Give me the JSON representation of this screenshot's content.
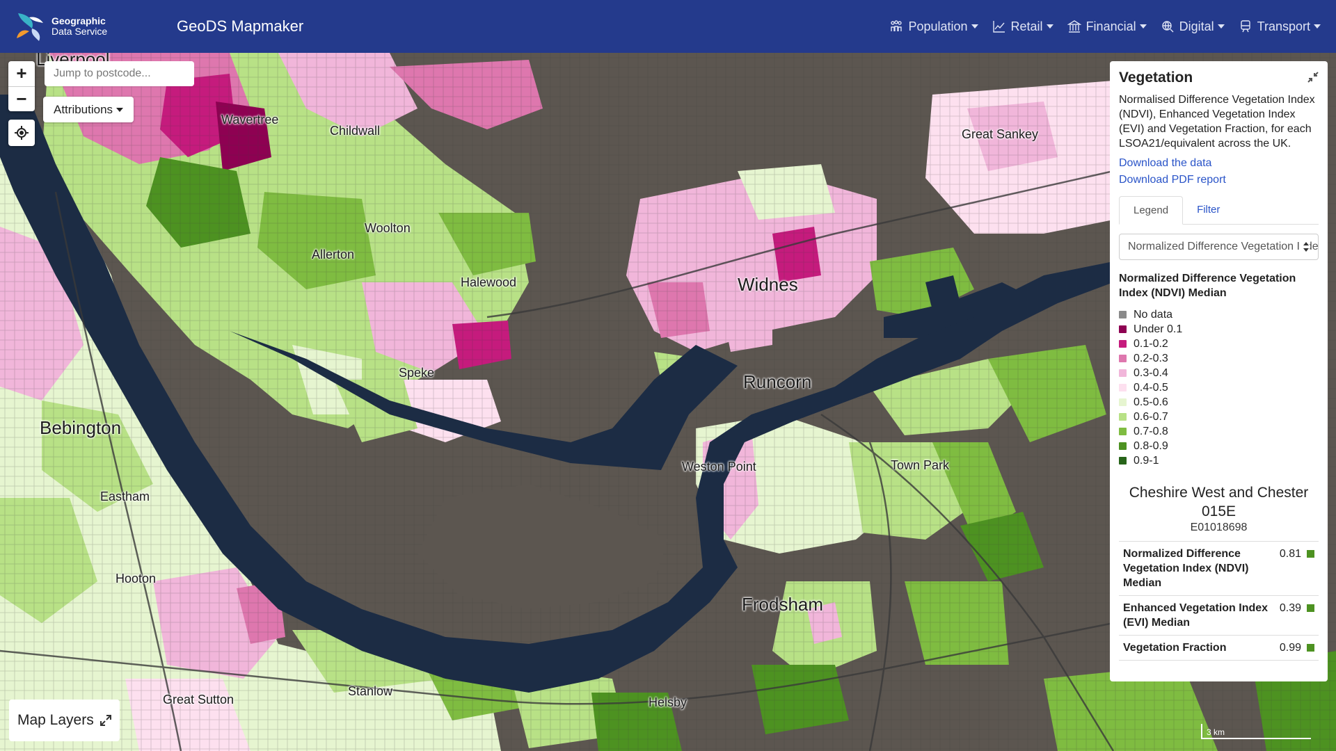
{
  "navbar": {
    "brand_line1": "Geographic",
    "brand_line2": "Data Service",
    "app_title": "GeoDS Mapmaker",
    "menu": [
      {
        "label": "Population",
        "icon": "people-icon"
      },
      {
        "label": "Retail",
        "icon": "chart-icon"
      },
      {
        "label": "Financial",
        "icon": "bank-icon"
      },
      {
        "label": "Digital",
        "icon": "network-icon"
      },
      {
        "label": "Transport",
        "icon": "train-icon"
      }
    ]
  },
  "map": {
    "postcode_placeholder": "Jump to postcode...",
    "attributions_label": "Attributions",
    "zoom_in": "+",
    "zoom_out": "−",
    "map_layers_label": "Map Layers",
    "scale_label": "3 km",
    "places": [
      {
        "name": "Liverpool"
      },
      {
        "name": "Wavertree"
      },
      {
        "name": "Childwall"
      },
      {
        "name": "Woolton"
      },
      {
        "name": "Allerton"
      },
      {
        "name": "Halewood"
      },
      {
        "name": "Speke"
      },
      {
        "name": "Widnes"
      },
      {
        "name": "Great Sankey"
      },
      {
        "name": "Runcorn"
      },
      {
        "name": "Weston Point"
      },
      {
        "name": "Town Park"
      },
      {
        "name": "Bebington"
      },
      {
        "name": "Eastham"
      },
      {
        "name": "Hooton"
      },
      {
        "name": "Frodsham"
      },
      {
        "name": "Great Sutton"
      },
      {
        "name": "Stanlow"
      },
      {
        "name": "Helsby"
      }
    ]
  },
  "panel": {
    "title": "Vegetation",
    "description": "Normalised Difference Vegetation Index (NDVI), Enhanced Vegetation Index (EVI) and Vegetation Fraction, for each LSOA21/equivalent across the UK.",
    "download_data": "Download the data",
    "download_pdf": "Download PDF report",
    "tabs": [
      "Legend",
      "Filter"
    ],
    "select_value": "Normalized Difference Vegetation Index (NDVI) Median",
    "legend_title": "Normalized Difference Vegetation Index (NDVI) Median",
    "legend": [
      {
        "label": "No data",
        "color": "#8a8a8a"
      },
      {
        "label": "Under 0.1",
        "color": "#8e0152"
      },
      {
        "label": "0.1-0.2",
        "color": "#c51b7d"
      },
      {
        "label": "0.2-0.3",
        "color": "#de77ae"
      },
      {
        "label": "0.3-0.4",
        "color": "#f1b6da"
      },
      {
        "label": "0.4-0.5",
        "color": "#fde0ef"
      },
      {
        "label": "0.5-0.6",
        "color": "#e6f5d0"
      },
      {
        "label": "0.6-0.7",
        "color": "#b8e186"
      },
      {
        "label": "0.7-0.8",
        "color": "#7fbc41"
      },
      {
        "label": "0.8-0.9",
        "color": "#4d9221"
      },
      {
        "label": "0.9-1",
        "color": "#276419"
      }
    ],
    "area_name": "Cheshire West and Chester 015E",
    "area_code": "E01018698",
    "stats": [
      {
        "label": "Normalized Difference Vegetation Index (NDVI) Median",
        "value": "0.81",
        "color": "#4d9221"
      },
      {
        "label": "Enhanced Vegetation Index (EVI) Median",
        "value": "0.39",
        "color": "#4d9221"
      },
      {
        "label": "Vegetation Fraction",
        "value": "0.99",
        "color": "#4d9221"
      }
    ]
  }
}
